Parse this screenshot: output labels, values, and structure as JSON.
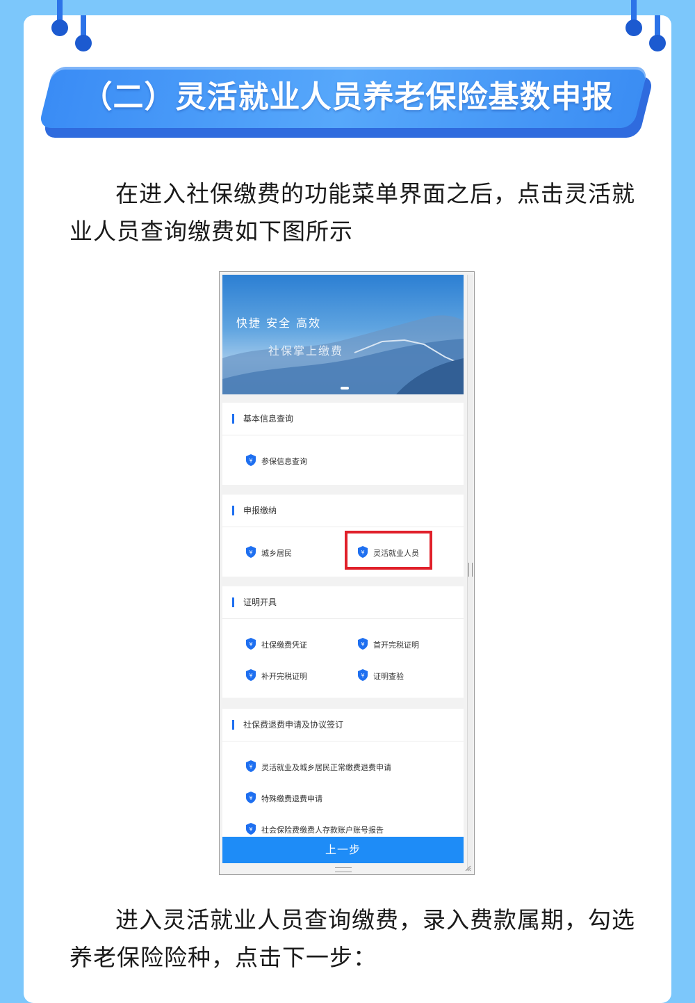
{
  "colors": {
    "page_bg": "#7cc7fb",
    "banner_blue": "#3a8cf5",
    "accent_blue": "#1e6ff0",
    "highlight_red": "#e0202a",
    "button_blue": "#1e8cf7"
  },
  "section_banner": {
    "title": "（二）灵活就业人员养老保险基数申报"
  },
  "intro_paragraph": "在进入社保缴费的功能菜单界面之后，点击灵活就业人员查询缴费如下图所示",
  "phone_screenshot": {
    "hero": {
      "slogan": "快捷 安全 高效",
      "subtitle": "社保掌上缴费"
    },
    "sections": [
      {
        "title": "基本信息查询",
        "items": [
          "参保信息查询"
        ]
      },
      {
        "title": "申报缴纳",
        "items": [
          "城乡居民",
          "灵活就业人员"
        ]
      },
      {
        "title": "证明开具",
        "items": [
          "社保缴费凭证",
          "首开完税证明",
          "补开完税证明",
          "证明查验"
        ]
      },
      {
        "title": "社保费退费申请及协议签订",
        "items": [
          "灵活就业及城乡居民正常缴费退费申请",
          "特殊缴费退费申请",
          "社会保险费缴费人存款账户账号报告"
        ]
      }
    ],
    "highlighted_item": "灵活就业人员",
    "prev_button": "上一步"
  },
  "outro_paragraph": "进入灵活就业人员查询缴费，录入费款属期，勾选养老保险险种，点击下一步："
}
